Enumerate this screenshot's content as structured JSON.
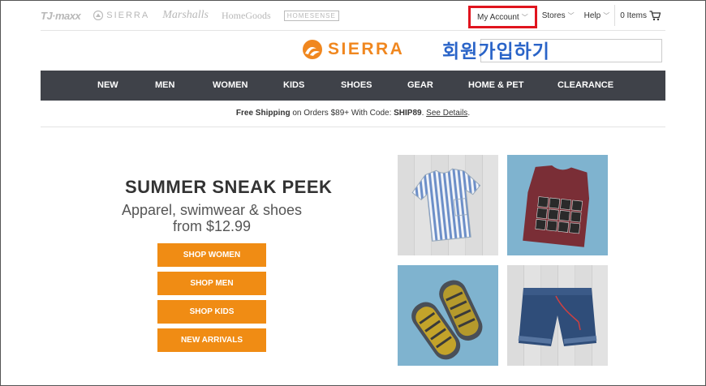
{
  "brands": [
    "TJ·maxx",
    "SIERRA",
    "Marshalls",
    "HomeGoods",
    "HOMESENSE"
  ],
  "utility": {
    "account": "My Account",
    "stores": "Stores",
    "help": "Help",
    "cart": "0 Items"
  },
  "logo": "SIERRA",
  "overlay_korean": "회원가입하기",
  "nav": [
    "NEW",
    "MEN",
    "WOMEN",
    "KIDS",
    "SHOES",
    "GEAR",
    "HOME & PET",
    "CLEARANCE"
  ],
  "promo": {
    "bold1": "Free Shipping",
    "text1": " on Orders $89+ With Code: ",
    "code": "SHIP89",
    "text2": ". ",
    "link": "See Details",
    "text3": "."
  },
  "hero": {
    "title": "SUMMER SNEAK PEEK",
    "subtitle_line1": "Apparel, swimwear & shoes",
    "subtitle_line2": "from $12.99"
  },
  "ctas": [
    "SHOP WOMEN",
    "SHOP MEN",
    "SHOP KIDS",
    "NEW ARRIVALS"
  ],
  "colors": {
    "accent": "#f08c14",
    "nav_bg": "#3f4249",
    "highlight": "#e0141e",
    "overlay_text": "#2a64c8"
  }
}
